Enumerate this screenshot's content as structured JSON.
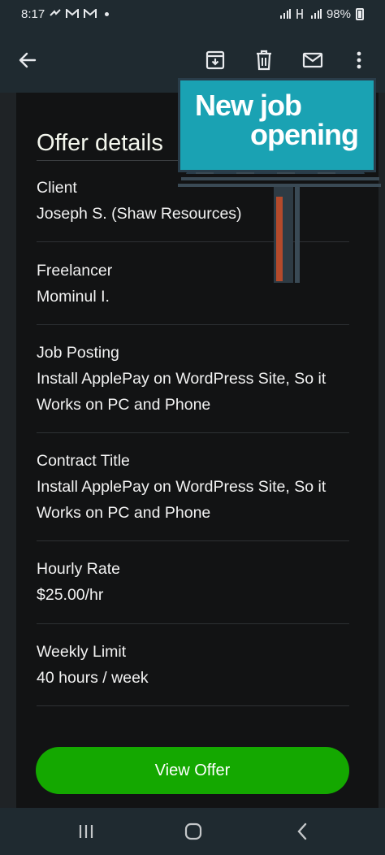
{
  "status_bar": {
    "time": "8:17",
    "notification_icons": [
      "messenger-icon",
      "gmail-icon",
      "gmail-icon",
      "dot-icon"
    ],
    "signal_text": "!!",
    "battery_percent": "98%"
  },
  "toolbar": {
    "back_icon": "arrow-left-icon",
    "archive_icon": "archive-icon",
    "delete_icon": "trash-icon",
    "mark_unread_icon": "mail-icon",
    "more_icon": "more-vert-icon"
  },
  "billboard": {
    "line1": "New job",
    "line2": "opening"
  },
  "offer": {
    "title": "Offer details",
    "fields": [
      {
        "label": "Client",
        "value": "Joseph S. (Shaw Resources)"
      },
      {
        "label": "Freelancer",
        "value": "Mominul I."
      },
      {
        "label": "Job Posting",
        "value": "Install ApplePay on WordPress Site, So it Works on PC and Phone"
      },
      {
        "label": "Contract Title",
        "value": "Install ApplePay on WordPress Site, So it Works on PC and Phone"
      },
      {
        "label": "Hourly Rate",
        "value": "$25.00/hr"
      },
      {
        "label": "Weekly Limit",
        "value": "40 hours / week"
      }
    ],
    "button_label": "View Offer"
  },
  "colors": {
    "accent_green": "#14a800",
    "billboard_teal": "#1aa2b3",
    "background": "#121314"
  },
  "navbar": {
    "recents_icon": "recents-icon",
    "home_icon": "home-icon",
    "back_icon": "back-chevron-icon"
  }
}
